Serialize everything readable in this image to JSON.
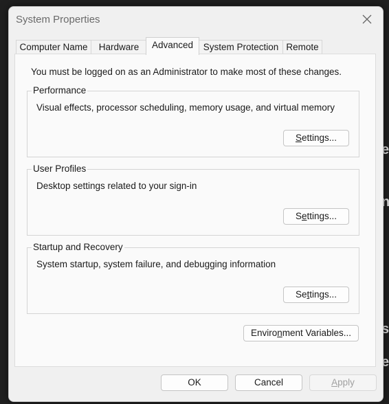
{
  "window": {
    "title": "System Properties"
  },
  "tabs": [
    {
      "label": "Computer Name",
      "active": false
    },
    {
      "label": "Hardware",
      "active": false
    },
    {
      "label": "Advanced",
      "active": true
    },
    {
      "label": "System Protection",
      "active": false
    },
    {
      "label": "Remote",
      "active": false
    }
  ],
  "advanced": {
    "note": "You must be logged on as an Administrator to make most of these changes.",
    "performance": {
      "title": "Performance",
      "description": "Visual effects, processor scheduling, memory usage, and virtual memory",
      "button": "Settings..."
    },
    "user_profiles": {
      "title": "User Profiles",
      "description": "Desktop settings related to your sign-in",
      "button": "Settings..."
    },
    "startup_recovery": {
      "title": "Startup and Recovery",
      "description": "System startup, system failure, and debugging information",
      "button": "Settings..."
    },
    "env_button": "Environment Variables..."
  },
  "footer": {
    "ok": "OK",
    "cancel": "Cancel",
    "apply": "Apply"
  },
  "background_fragments": [
    "er",
    "ne",
    "s.",
    "ev"
  ]
}
